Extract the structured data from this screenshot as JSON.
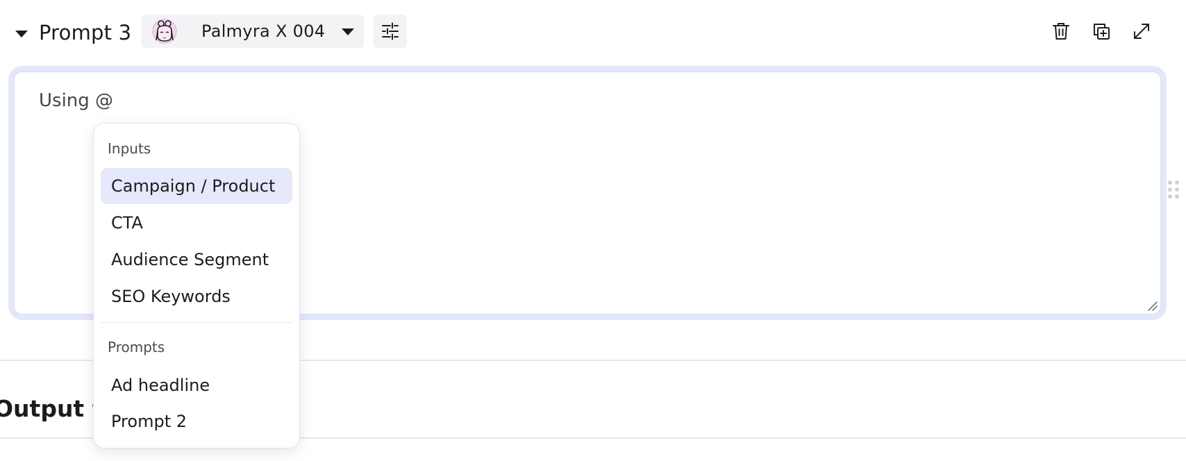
{
  "prompt": {
    "title": "Prompt 3",
    "model": {
      "name": "Palmyra X 004"
    }
  },
  "editor": {
    "text": "Using @"
  },
  "mention_menu": {
    "inputs_label": "Inputs",
    "inputs": [
      "Campaign / Product",
      "CTA",
      "Audience Segment",
      "SEO Keywords"
    ],
    "prompts_label": "Prompts",
    "prompts": [
      "Ad headline",
      "Prompt 2"
    ],
    "selected": "Campaign / Product"
  },
  "output_section": {
    "heading": "Output for"
  },
  "colors": {
    "accent_highlight": "#e6e8fb",
    "editor_border": "#e4e6fb",
    "button_bg": "#f3f3f6"
  },
  "icons": {
    "collapse": "caret-down-icon",
    "model_avatar": "avatar-icon",
    "model_dropdown": "caret-down-icon",
    "settings": "sliders-icon",
    "delete": "trash-icon",
    "duplicate": "duplicate-icon",
    "expand": "expand-icon",
    "drag": "drag-handle-icon",
    "resize": "resize-handle-icon"
  }
}
